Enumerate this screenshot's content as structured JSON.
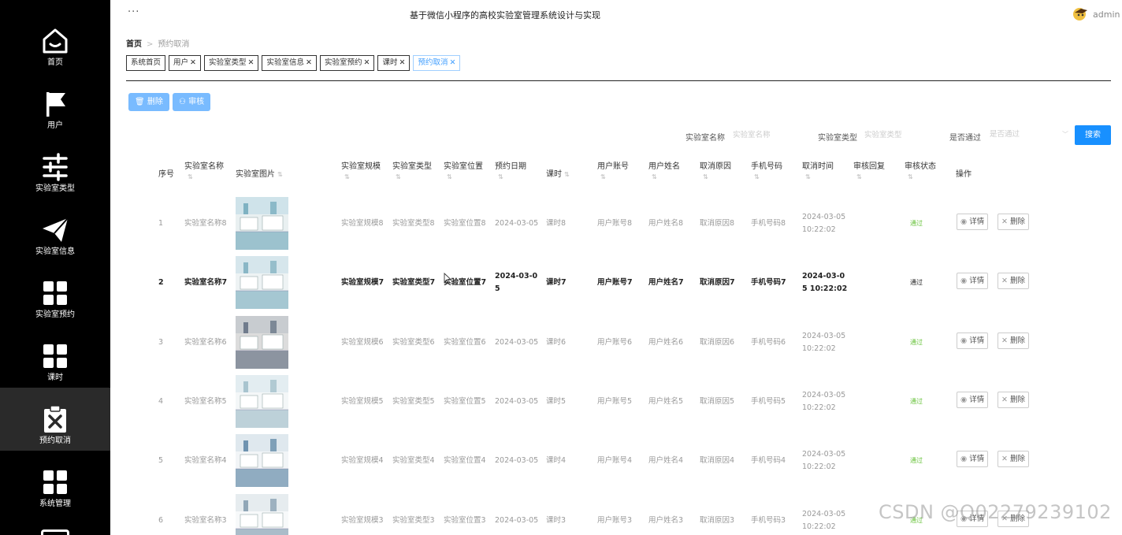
{
  "sidebar": {
    "items": [
      {
        "label": "首页",
        "icon": "home-icon"
      },
      {
        "label": "用户",
        "icon": "flag-icon"
      },
      {
        "label": "实验室类型",
        "icon": "sliders-icon"
      },
      {
        "label": "实验室信息",
        "icon": "send-icon"
      },
      {
        "label": "实验室预约",
        "icon": "grid-icon"
      },
      {
        "label": "课时",
        "icon": "grid-icon"
      },
      {
        "label": "预约取消",
        "icon": "clipboard-x-icon"
      },
      {
        "label": "系统管理",
        "icon": "grid-icon"
      }
    ],
    "active_index": 6
  },
  "header": {
    "dots": "···",
    "title": "基于微信小程序的高校实验室管理系统设计与实现",
    "user": "admin"
  },
  "breadcrumb": {
    "home": "首页",
    "current": "预约取消"
  },
  "tags": [
    {
      "label": "系统首页",
      "closable": false
    },
    {
      "label": "用户",
      "closable": true
    },
    {
      "label": "实验室类型",
      "closable": true
    },
    {
      "label": "实验室信息",
      "closable": true
    },
    {
      "label": "实验室预约",
      "closable": true
    },
    {
      "label": "课时",
      "closable": true
    },
    {
      "label": "预约取消",
      "closable": true
    }
  ],
  "toolbar": {
    "delete_label": "删除",
    "audit_label": "审核"
  },
  "search": {
    "lab_name_label": "实验室名称",
    "lab_name_placeholder": "实验室名称",
    "lab_type_label": "实验室类型",
    "lab_type_placeholder": "实验室类型",
    "approved_label": "是否通过",
    "approved_placeholder": "是否通过",
    "button": "搜索"
  },
  "table": {
    "headers": {
      "index": "序号",
      "lab_name": "实验室名称",
      "lab_image": "实验室图片",
      "lab_scale": "实验室规模",
      "lab_type": "实验室类型",
      "lab_location": "实验室位置",
      "date": "预约日期",
      "period": "课时",
      "account": "用户账号",
      "username": "用户姓名",
      "reason": "取消原因",
      "phone": "手机号码",
      "cancel_time": "取消时间",
      "reply": "审核回复",
      "status": "审核状态",
      "ops": "操作"
    },
    "detail_label": "详情",
    "delete_label": "删除",
    "rows": [
      {
        "index": "1",
        "lab_name": "实验室名称8",
        "lab_scale": "实验室规模8",
        "lab_type": "实验室类型8",
        "lab_location": "实验室位置8",
        "date": "2024-03-05",
        "period": "课时8",
        "account": "用户账号8",
        "username": "用户姓名8",
        "reason": "取消原因8",
        "phone": "手机号码8",
        "cancel_time": "2024-03-05 10:22:02",
        "reply": "",
        "status": "通过"
      },
      {
        "index": "2",
        "lab_name": "实验室名称7",
        "lab_scale": "实验室规模7",
        "lab_type": "实验室类型7",
        "lab_location": "实验室位置7",
        "date": "2024-03-05",
        "period": "课时7",
        "account": "用户账号7",
        "username": "用户姓名7",
        "reason": "取消原因7",
        "phone": "手机号码7",
        "cancel_time": "2024-03-05 10:22:02",
        "reply": "",
        "status": "通过"
      },
      {
        "index": "3",
        "lab_name": "实验室名称6",
        "lab_scale": "实验室规模6",
        "lab_type": "实验室类型6",
        "lab_location": "实验室位置6",
        "date": "2024-03-05",
        "period": "课时6",
        "account": "用户账号6",
        "username": "用户姓名6",
        "reason": "取消原因6",
        "phone": "手机号码6",
        "cancel_time": "2024-03-05 10:22:02",
        "reply": "",
        "status": "通过"
      },
      {
        "index": "4",
        "lab_name": "实验室名称5",
        "lab_scale": "实验室规模5",
        "lab_type": "实验室类型5",
        "lab_location": "实验室位置5",
        "date": "2024-03-05",
        "period": "课时5",
        "account": "用户账号5",
        "username": "用户姓名5",
        "reason": "取消原因5",
        "phone": "手机号码5",
        "cancel_time": "2024-03-05 10:22:02",
        "reply": "",
        "status": "通过"
      },
      {
        "index": "5",
        "lab_name": "实验室名称4",
        "lab_scale": "实验室规模4",
        "lab_type": "实验室类型4",
        "lab_location": "实验室位置4",
        "date": "2024-03-05",
        "period": "课时4",
        "account": "用户账号4",
        "username": "用户姓名4",
        "reason": "取消原因4",
        "phone": "手机号码4",
        "cancel_time": "2024-03-05 10:22:02",
        "reply": "",
        "status": "通过"
      },
      {
        "index": "6",
        "lab_name": "实验室名称3",
        "lab_scale": "实验室规模3",
        "lab_type": "实验室类型3",
        "lab_location": "实验室位置3",
        "date": "2024-03-05",
        "period": "课时3",
        "account": "用户账号3",
        "username": "用户姓名3",
        "reason": "取消原因3",
        "phone": "手机号码3",
        "cancel_time": "2024-03-05 10:22:02",
        "reply": "",
        "status": "通过"
      }
    ],
    "highlighted_row": 1
  },
  "watermark": "CSDN @Q02279239102",
  "colors": {
    "sidebar_bg": "#000000",
    "primary": "#1890ff",
    "light_primary": "#79bbff",
    "status_green": "#67c23a"
  }
}
